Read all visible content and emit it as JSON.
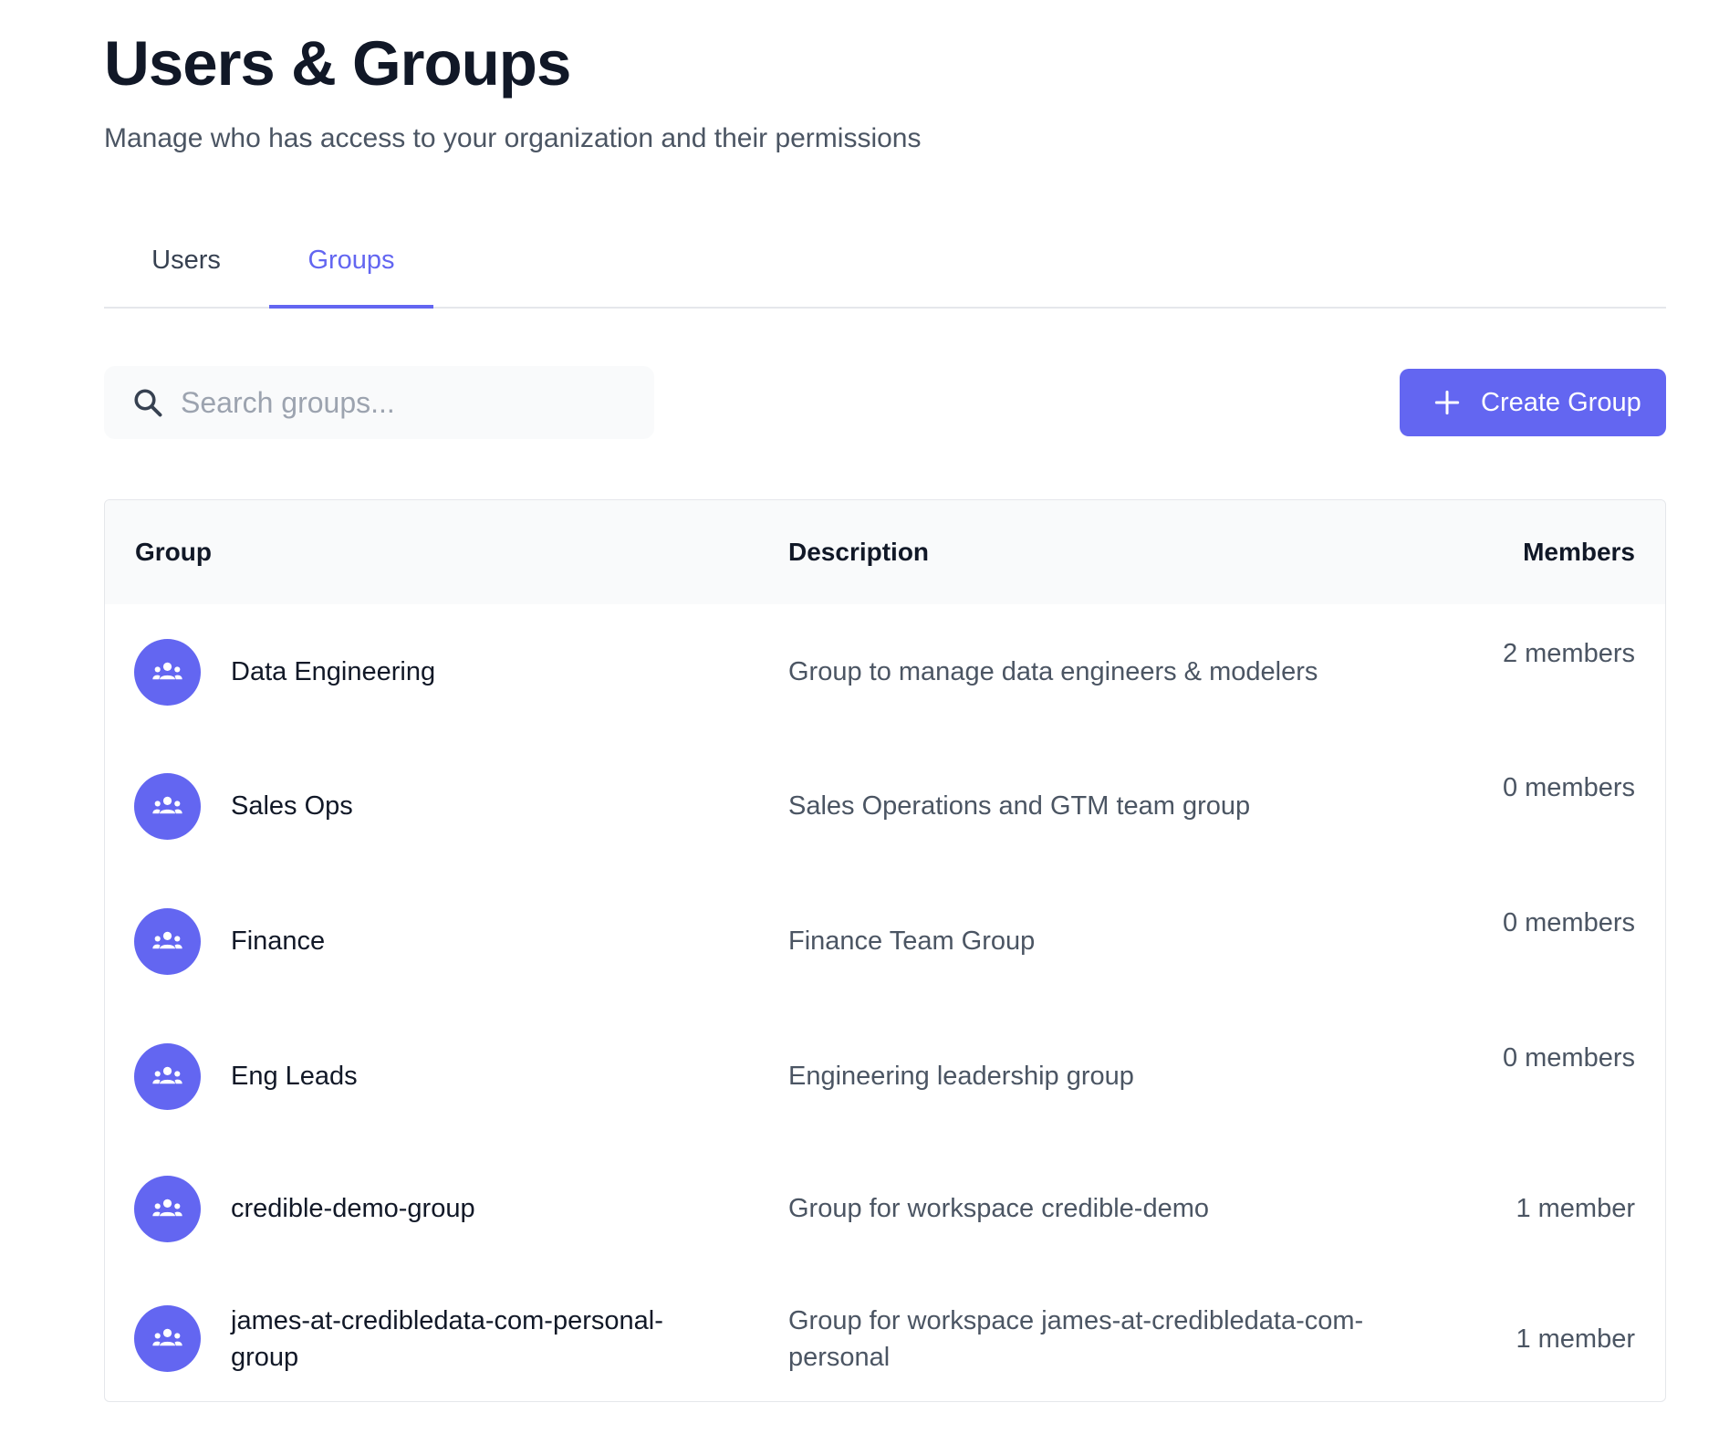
{
  "header": {
    "title": "Users & Groups",
    "subtitle": "Manage who has access to your organization and their permissions"
  },
  "tabs": [
    {
      "label": "Users",
      "active": false
    },
    {
      "label": "Groups",
      "active": true
    }
  ],
  "search": {
    "placeholder": "Search groups...",
    "value": ""
  },
  "create_button": {
    "label": "Create Group",
    "icon": "plus-icon"
  },
  "table": {
    "columns": [
      "Group",
      "Description",
      "Members"
    ],
    "rows": [
      {
        "name": "Data Engineering",
        "description": "Group to manage data engineers & modelers",
        "members": "2 members"
      },
      {
        "name": "Sales Ops",
        "description": "Sales Operations and GTM team group",
        "members": "0 members"
      },
      {
        "name": "Finance",
        "description": "Finance Team Group",
        "members": "0 members"
      },
      {
        "name": "Eng Leads",
        "description": "Engineering leadership group",
        "members": "0 members"
      },
      {
        "name": "credible-demo-group",
        "description": "Group for workspace credible-demo",
        "members": "1 member"
      },
      {
        "name": "james-at-credibledata-com-personal-group",
        "description": "Group for workspace james-at-credibledata-com-personal",
        "members": "1 member"
      }
    ]
  },
  "colors": {
    "accent": "#6366f1",
    "text_primary": "#111827",
    "text_secondary": "#4b5563",
    "header_bg": "#f9fafb",
    "border": "#e5e7eb"
  },
  "icons": {
    "row_avatar": "group-icon",
    "search": "search-icon"
  }
}
